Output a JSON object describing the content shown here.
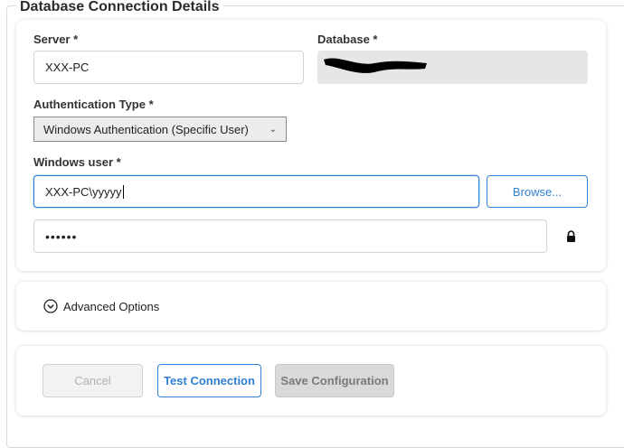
{
  "section": {
    "title": "Database Connection Details"
  },
  "fields": {
    "server_label": "Server *",
    "server_value": "XXX-PC",
    "database_label": "Database *",
    "database_value": "",
    "auth_label": "Authentication Type *",
    "auth_selected": "Windows Authentication (Specific User)",
    "user_label": "Windows user *",
    "user_value": "XXX-PC\\yyyyy",
    "password_mask": "••••••",
    "browse_label": "Browse..."
  },
  "advanced": {
    "label": "Advanced Options"
  },
  "actions": {
    "cancel_label": "Cancel",
    "test_label": "Test Connection",
    "save_label": "Save Configuration"
  },
  "icons": {
    "lock": "lock-icon",
    "chevron_circle": "chevron-down-circle-icon",
    "select_caret": "chevron-down-icon"
  },
  "colors": {
    "accent": "#2f7fd3",
    "disabled_bg": "#e6e6e6"
  }
}
